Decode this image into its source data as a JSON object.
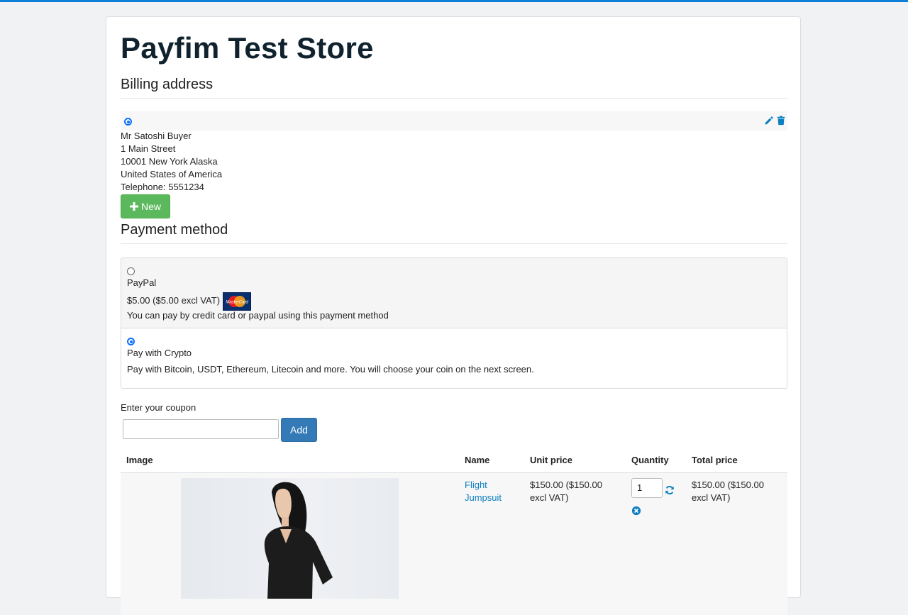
{
  "store": {
    "title": "Payfim Test Store"
  },
  "billing": {
    "heading": "Billing address",
    "address": {
      "name": "Mr Satoshi Buyer",
      "street": "1 Main Street",
      "city_line": "10001 New York Alaska",
      "country": "United States of America",
      "telephone": "Telephone: 5551234",
      "selected": true
    },
    "new_button_label": "New"
  },
  "payment": {
    "heading": "Payment method",
    "options": [
      {
        "name": "PayPal",
        "price": "$5.00 ($5.00 excl VAT)",
        "logo_text": "MasterCard",
        "description": "You can pay by credit card or paypal using this payment method",
        "selected": false
      },
      {
        "name": "Pay with Crypto",
        "description": "Pay with Bitcoin, USDT, Ethereum, Litecoin and more. You will choose your coin on the next screen.",
        "selected": true
      }
    ]
  },
  "coupon": {
    "label": "Enter your coupon",
    "value": "",
    "add_label": "Add"
  },
  "cart": {
    "headers": {
      "image": "Image",
      "name": "Name",
      "unit_price": "Unit price",
      "quantity": "Quantity",
      "total_price": "Total price"
    },
    "items": [
      {
        "name_line1": "Flight",
        "name_line2": "Jumpsuit",
        "unit_price_line1": "$150.00 ($150.00",
        "unit_price_line2": "excl VAT)",
        "quantity": "1",
        "total_price_line1": "$150.00 ($150.00",
        "total_price_line2": "excl VAT)"
      }
    ]
  },
  "colors": {
    "accent": "#0d7fd6",
    "success": "#5cb85c",
    "primary": "#337ab7",
    "link": "#0d7fc0"
  },
  "icons": [
    "pencil-icon",
    "trash-icon",
    "plus-icon",
    "refresh-icon",
    "remove-icon"
  ]
}
